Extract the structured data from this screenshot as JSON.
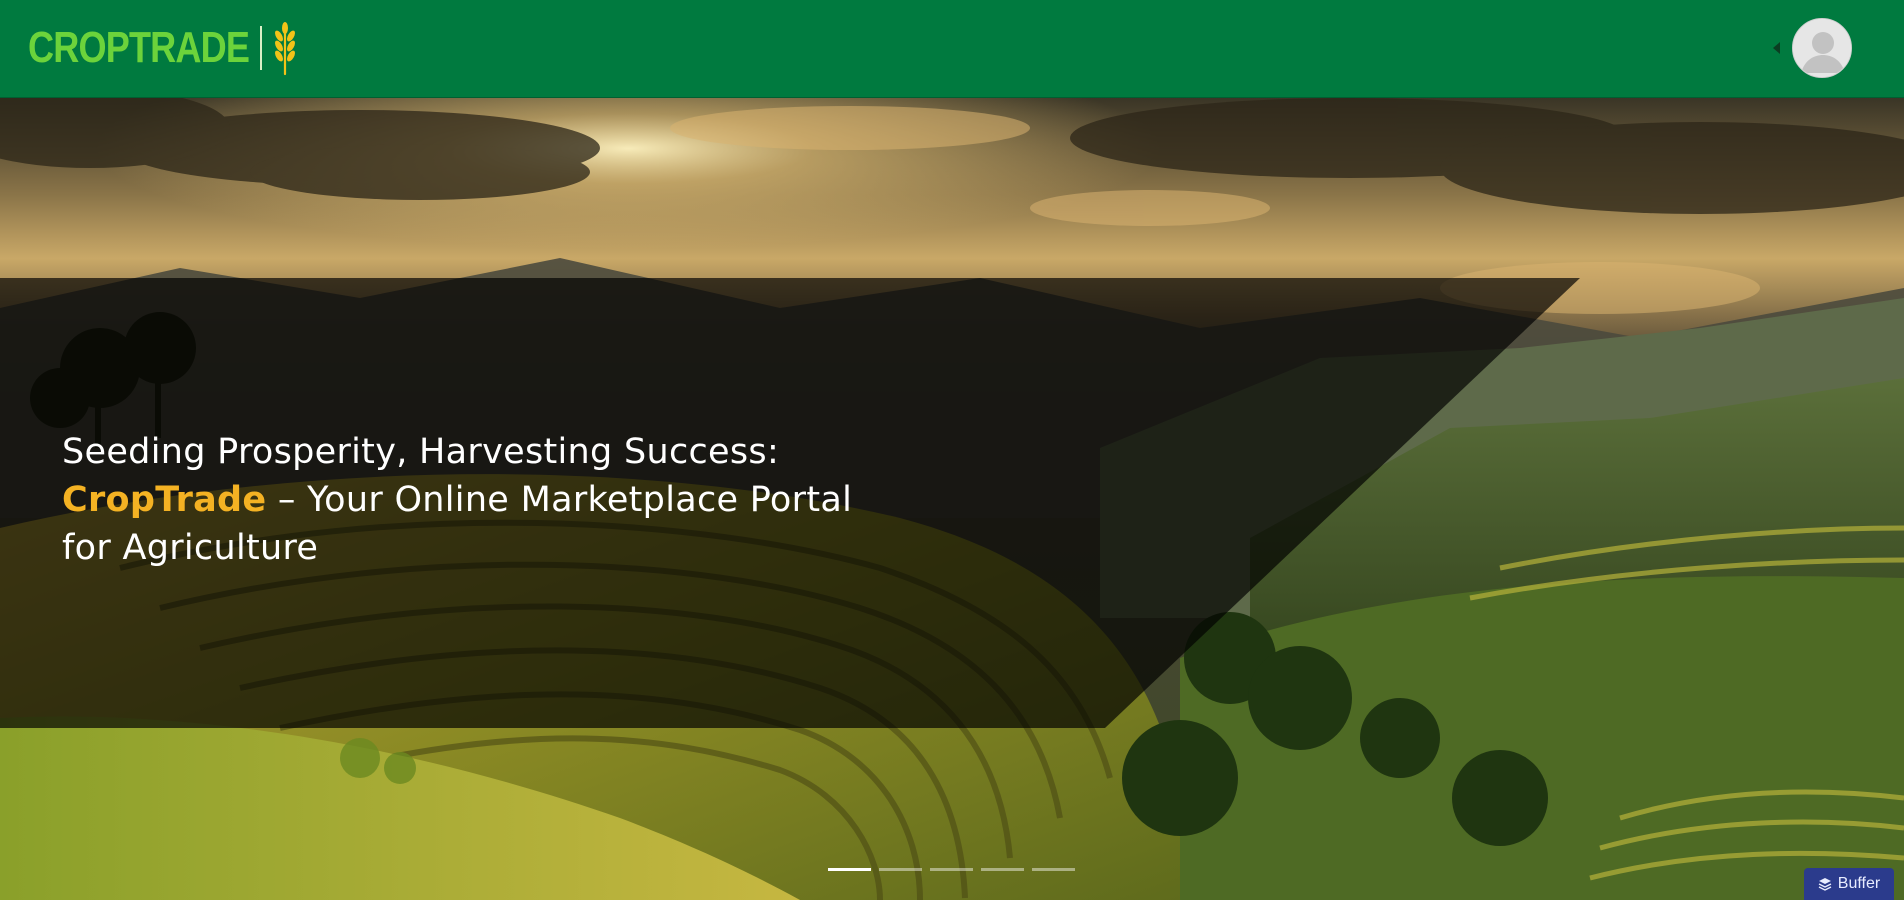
{
  "header": {
    "logo_text": "CROPTRADE",
    "logo_icon": "wheat-icon",
    "profile_caret_icon": "caret-left-icon",
    "avatar_icon": "user-avatar-icon",
    "background_color": "#007a3f",
    "logo_color": "#6cd33b"
  },
  "hero": {
    "headline_line1": "Seeding Prosperity, Harvesting Success:",
    "brand": "CropTrade",
    "headline_line2_rest": " – Your Online Marketplace Portal",
    "headline_line3": "for Agriculture",
    "brand_color": "#f4b223",
    "background_image": "rice-terraces-mountains-sunset"
  },
  "carousel": {
    "slide_count": 5,
    "active_index": 0
  },
  "buffer": {
    "label": "Buffer",
    "icon": "buffer-stack-icon",
    "color": "#2b3b8c"
  }
}
